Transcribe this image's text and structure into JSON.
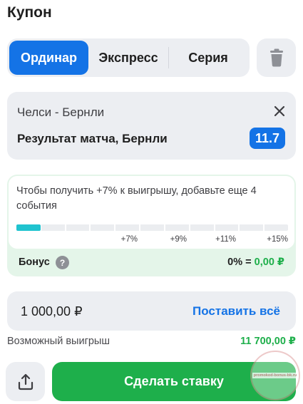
{
  "coupon": {
    "title": "Купон"
  },
  "tabs": [
    {
      "label": "Ординар",
      "active": true
    },
    {
      "label": "Экспресс",
      "active": false
    },
    {
      "label": "Серия",
      "active": false
    }
  ],
  "icons": {
    "trash": "trash-icon",
    "close": "close-icon",
    "help": "help-icon",
    "share": "share-icon"
  },
  "bet": {
    "teams": "Челси - Бернли",
    "market": "Результат матча, Бернли",
    "odds": "11.7"
  },
  "bonus": {
    "message": "Чтобы получить +7% к выигрышу, добавьте еще 4 события",
    "progress_fraction": 0.09,
    "progress_segments": 11,
    "ticks": [
      "+7%",
      "+9%",
      "+11%",
      "+15%"
    ],
    "label": "Бонус",
    "help_symbol": "?",
    "percent_text": "0% =",
    "amount": "0,00 ₽"
  },
  "stake": {
    "amount": "1 000,00 ₽",
    "all_label": "Поставить всё"
  },
  "potential_win": {
    "label": "Возможный выигрыш",
    "value": "11 700,00 ₽"
  },
  "actions": {
    "place_bet_label": "Сделать ставку"
  },
  "watermark": {
    "text": "promokod-bonus-bk.ru"
  },
  "colors": {
    "accent_blue": "#1473e6",
    "accent_green": "#1eaf4b",
    "progress_teal": "#20c3cf",
    "panel_gray": "#eceef2",
    "bonus_bg": "#e4f5e9"
  }
}
